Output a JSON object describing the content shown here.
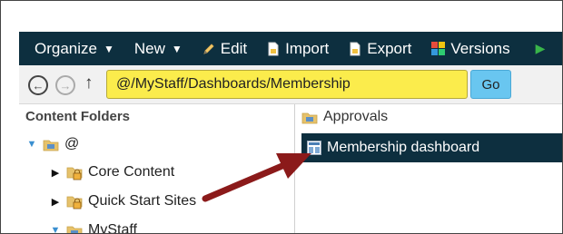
{
  "toolbar": {
    "organize_label": "Organize",
    "new_label": "New",
    "edit_label": "Edit",
    "import_label": "Import",
    "export_label": "Export",
    "versions_label": "Versions"
  },
  "address_bar": {
    "path_value": "@/MyStaff/Dashboards/Membership",
    "go_label": "Go"
  },
  "left_pane": {
    "header": "Content Folders",
    "tree": [
      {
        "label": "@",
        "expanded": true
      },
      {
        "label": "Core Content",
        "expanded": false,
        "locked": true
      },
      {
        "label": "Quick Start Sites",
        "expanded": false,
        "locked": true
      },
      {
        "label": "MyStaff",
        "expanded": true
      }
    ]
  },
  "right_pane": {
    "items": [
      {
        "label": "Approvals",
        "icon": "folder-icon"
      },
      {
        "label": "Membership dashboard",
        "icon": "dashboard-icon",
        "selected": true
      }
    ]
  },
  "colors": {
    "toolbar_bg": "#0d2f3f",
    "path_highlight": "#fbec4c",
    "go_button": "#69c6f0",
    "annotation_arrow": "#8b1a1a",
    "selection_bg": "#0d2f3f"
  }
}
